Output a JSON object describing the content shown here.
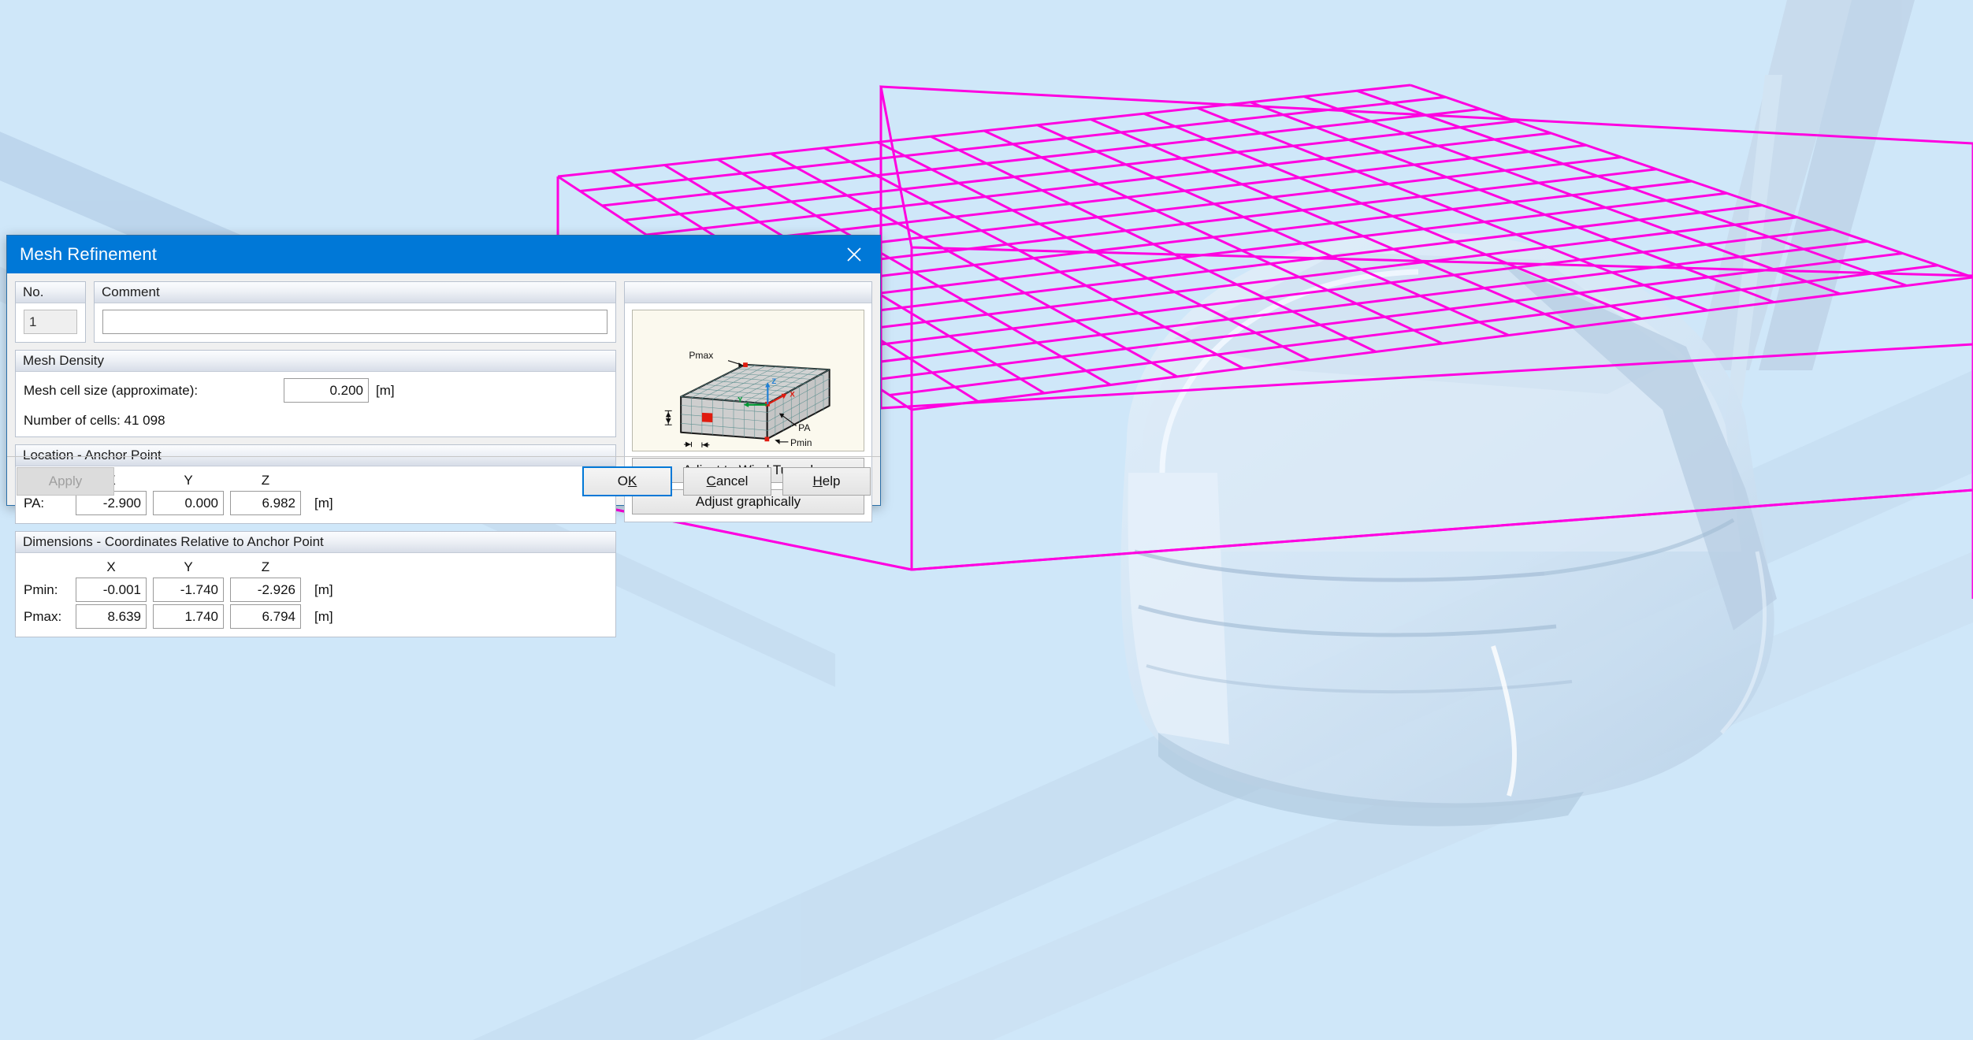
{
  "viewport": {
    "background_color": "#cfe7f9",
    "wireframe_color": "#ff00e0",
    "object_label": "vehicle-model",
    "refinement_box_label": "mesh-refinement-box"
  },
  "dialog": {
    "title": "Mesh Refinement",
    "close_icon": "close-icon"
  },
  "no_group": {
    "header": "No.",
    "value": "1"
  },
  "comment_group": {
    "header": "Comment",
    "value": "",
    "placeholder": ""
  },
  "mesh_density": {
    "header": "Mesh Density",
    "cell_size_label": "Mesh cell size (approximate):",
    "cell_size_value": "0.200",
    "cell_size_unit": "[m]",
    "number_of_cells": "Number of cells: 41 098"
  },
  "location": {
    "header": "Location - Anchor Point",
    "axes": [
      "X",
      "Y",
      "Z"
    ],
    "rows": [
      {
        "label": "PA:",
        "values": [
          "-2.900",
          "0.000",
          "6.982"
        ],
        "unit": "[m]"
      }
    ]
  },
  "dimensions": {
    "header": "Dimensions - Coordinates Relative to Anchor Point",
    "axes": [
      "X",
      "Y",
      "Z"
    ],
    "rows": [
      {
        "label": "Pmin:",
        "values": [
          "-0.001",
          "-1.740",
          "-2.926"
        ],
        "unit": "[m]"
      },
      {
        "label": "Pmax:",
        "values": [
          "8.639",
          "1.740",
          "6.794"
        ],
        "unit": "[m]"
      }
    ]
  },
  "right_panel": {
    "header": "",
    "preview": {
      "name": "mesh-refinement-diagram",
      "labels": {
        "pmax": "Pmax",
        "pmin": "Pmin",
        "pa": "PA",
        "axis_x": "X",
        "axis_y": "Y",
        "axis_z": "Z"
      },
      "colors": {
        "background": "#fbf9ee",
        "box_fill": "#cfcfcf",
        "box_edge": "#1a1a1a",
        "grid": "#5c8f8f",
        "marker": "#e01b0f",
        "axis_x": "#e01b0f",
        "axis_y": "#009933",
        "axis_z": "#1f7fd4"
      }
    },
    "adjust_wind_tunnel_label": "Adjust to Wind Tunnel",
    "adjust_graphically_label": "Adjust graphically"
  },
  "footer": {
    "apply_label": "Apply",
    "ok": {
      "pre": "O",
      "acc": "K",
      "post": ""
    },
    "cancel": {
      "pre": "",
      "acc": "C",
      "post": "ancel"
    },
    "help": {
      "pre": "",
      "acc": "H",
      "post": "elp"
    }
  }
}
